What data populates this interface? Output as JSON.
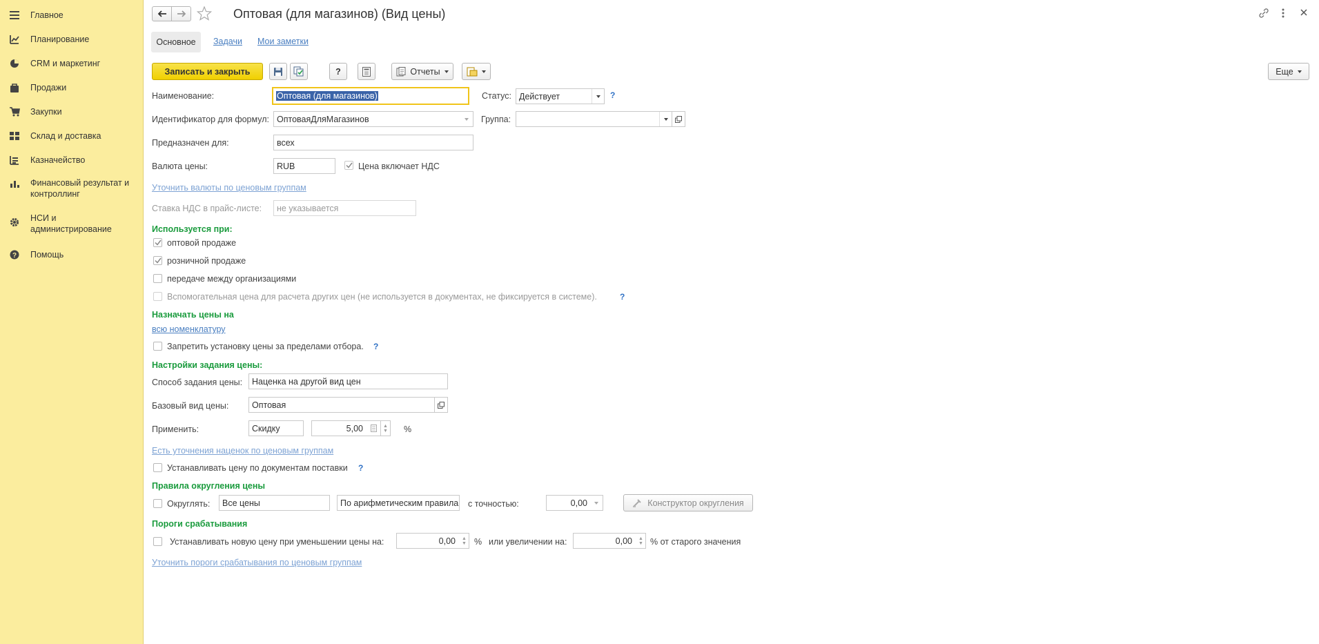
{
  "sidebar": {
    "items": [
      {
        "label": "Главное",
        "icon": "menu-icon"
      },
      {
        "label": "Планирование",
        "icon": "planning-icon"
      },
      {
        "label": "CRM и маркетинг",
        "icon": "pie-chart-icon"
      },
      {
        "label": "Продажи",
        "icon": "bag-icon"
      },
      {
        "label": "Закупки",
        "icon": "cart-icon"
      },
      {
        "label": "Склад и доставка",
        "icon": "warehouse-icon"
      },
      {
        "label": "Казначейство",
        "icon": "treasury-icon"
      },
      {
        "label": "Финансовый результат и контроллинг",
        "icon": "bar-chart-icon"
      },
      {
        "label": "НСИ и администрирование",
        "icon": "gear-icon"
      },
      {
        "label": "Помощь",
        "icon": "help-icon"
      }
    ]
  },
  "window": {
    "title": "Оптовая (для магазинов) (Вид цены)"
  },
  "tabs": [
    "Основное",
    "Задачи",
    "Мои заметки"
  ],
  "toolbar": {
    "save_close": "Записать и закрыть",
    "help": "?",
    "reports": "Отчеты",
    "more": "Еще"
  },
  "form": {
    "name_label": "Наименование:",
    "name_value": "Оптовая (для магазинов)",
    "status_label": "Статус:",
    "status_value": "Действует",
    "formula_id_label": "Идентификатор для формул:",
    "formula_id_value": "ОптоваяДляМагазинов",
    "group_label": "Группа:",
    "group_value": "",
    "intended_label": "Предназначен для:",
    "intended_value": "всех",
    "currency_label": "Валюта цены:",
    "currency_value": "RUB",
    "vat_included_label": "Цена включает НДС",
    "currency_link": "Уточнить валюты по ценовым группам",
    "vat_rate_label": "Ставка НДС в прайс-листе:",
    "vat_rate_value": "не указывается"
  },
  "used_for": {
    "title": "Используется при:",
    "wholesale": "оптовой продаже",
    "retail": "розничной продаже",
    "transfer": "передаче между организациями",
    "auxiliary": "Вспомогательная цена для расчета других цен (не используется в документах, не фиксируется в системе)."
  },
  "assign": {
    "title": "Назначать цены на",
    "link": "всю номенклатуру",
    "forbid_label": "Запретить установку цены за пределами отбора."
  },
  "price_settings": {
    "title": "Настройки задания цены:",
    "method_label": "Способ задания цены:",
    "method_value": "Наценка на другой вид цен",
    "base_label": "Базовый вид цены:",
    "base_value": "Оптовая",
    "apply_label": "Применить:",
    "apply_value": "Скидку",
    "percent_value": "5,00",
    "percent_sign": "%",
    "markup_link": "Есть уточнения наценок по ценовым группам",
    "set_by_docs_label": "Устанавливать цену по документам поставки"
  },
  "rounding": {
    "title": "Правила округления цены",
    "round_label": "Округлять:",
    "prices_value": "Все цены",
    "rule_value": "По арифметическим правилам",
    "precision_label": "с точностью:",
    "precision_value": "0,00",
    "constructor_btn": "Конструктор округления"
  },
  "thresholds": {
    "title": "Пороги срабатывания",
    "decrease_label": "Устанавливать новую цену при уменьшении цены на:",
    "decrease_value": "0,00",
    "percent1": "%",
    "increase_label": "или увеличении на:",
    "increase_value": "0,00",
    "percent2": "% от старого значения",
    "link": "Уточнить пороги срабатывания по ценовым группам"
  },
  "colors": {
    "sidebar_bg": "#fbed9e",
    "section_green": "#1a9b3d",
    "primary_button": "#f0d000",
    "link_blue": "#4a7fc1"
  }
}
